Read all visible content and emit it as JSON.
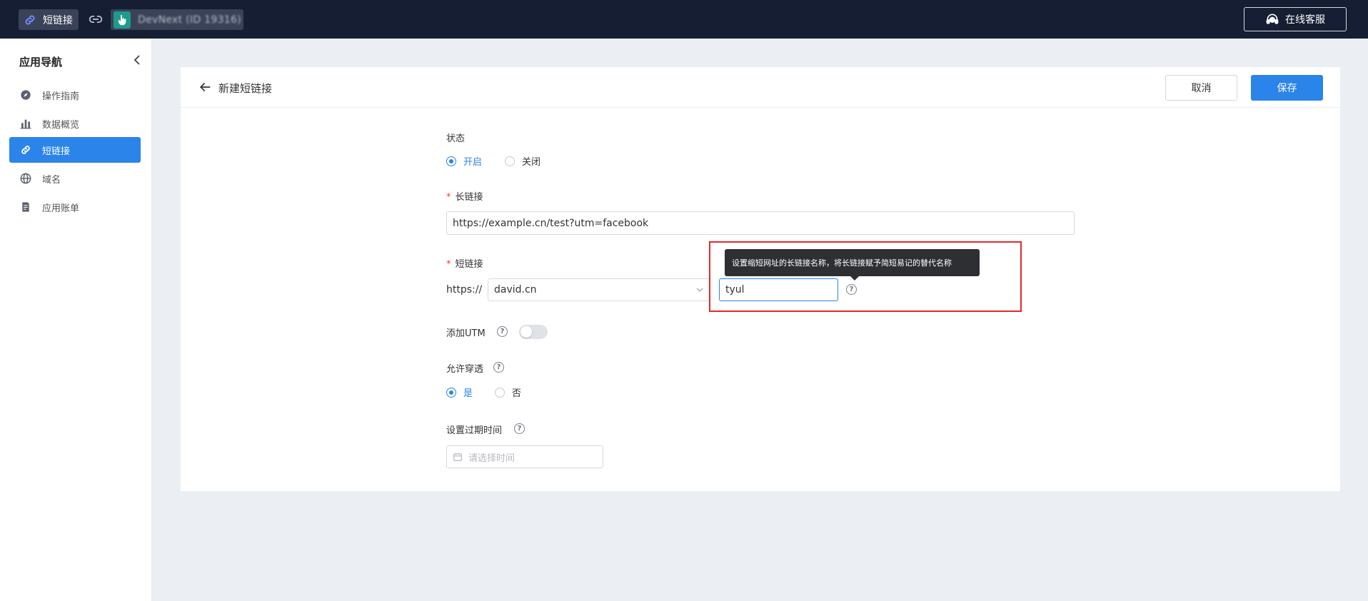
{
  "topbar": {
    "app_name": "短链接",
    "project_name": "DevNext (ID 19316)",
    "service_label": "在线客服"
  },
  "sidebar": {
    "title": "应用导航",
    "items": [
      {
        "label": "操作指南",
        "icon": "compass-icon"
      },
      {
        "label": "数据概览",
        "icon": "bar-chart-icon"
      },
      {
        "label": "短链接",
        "icon": "link-icon",
        "active": true
      },
      {
        "label": "域名",
        "icon": "globe-icon"
      },
      {
        "label": "应用账单",
        "icon": "bill-icon"
      }
    ]
  },
  "page": {
    "title": "新建短链接",
    "cancel_label": "取消",
    "save_label": "保存"
  },
  "form": {
    "status": {
      "label": "状态",
      "options": [
        "开启",
        "关闭"
      ],
      "selected": "开启"
    },
    "long_link": {
      "label": "长链接",
      "value": "https://example.cn/test?utm=facebook"
    },
    "short_link": {
      "label": "短链接",
      "prefix": "https://",
      "domain": "david.cn",
      "slug": "tyul",
      "tooltip": "设置缩短网址的长链接名称，将长链接赋予简短易记的替代名称"
    },
    "utm": {
      "label": "添加UTM",
      "enabled": false
    },
    "passthrough": {
      "label": "允许穿透",
      "options": [
        "是",
        "否"
      ],
      "selected": "是"
    },
    "expiry": {
      "label": "设置过期时间",
      "placeholder": "请选择时间"
    }
  },
  "colors": {
    "accent": "#2b84ea",
    "topbar": "#161e33",
    "highlight": "#e8262b"
  }
}
